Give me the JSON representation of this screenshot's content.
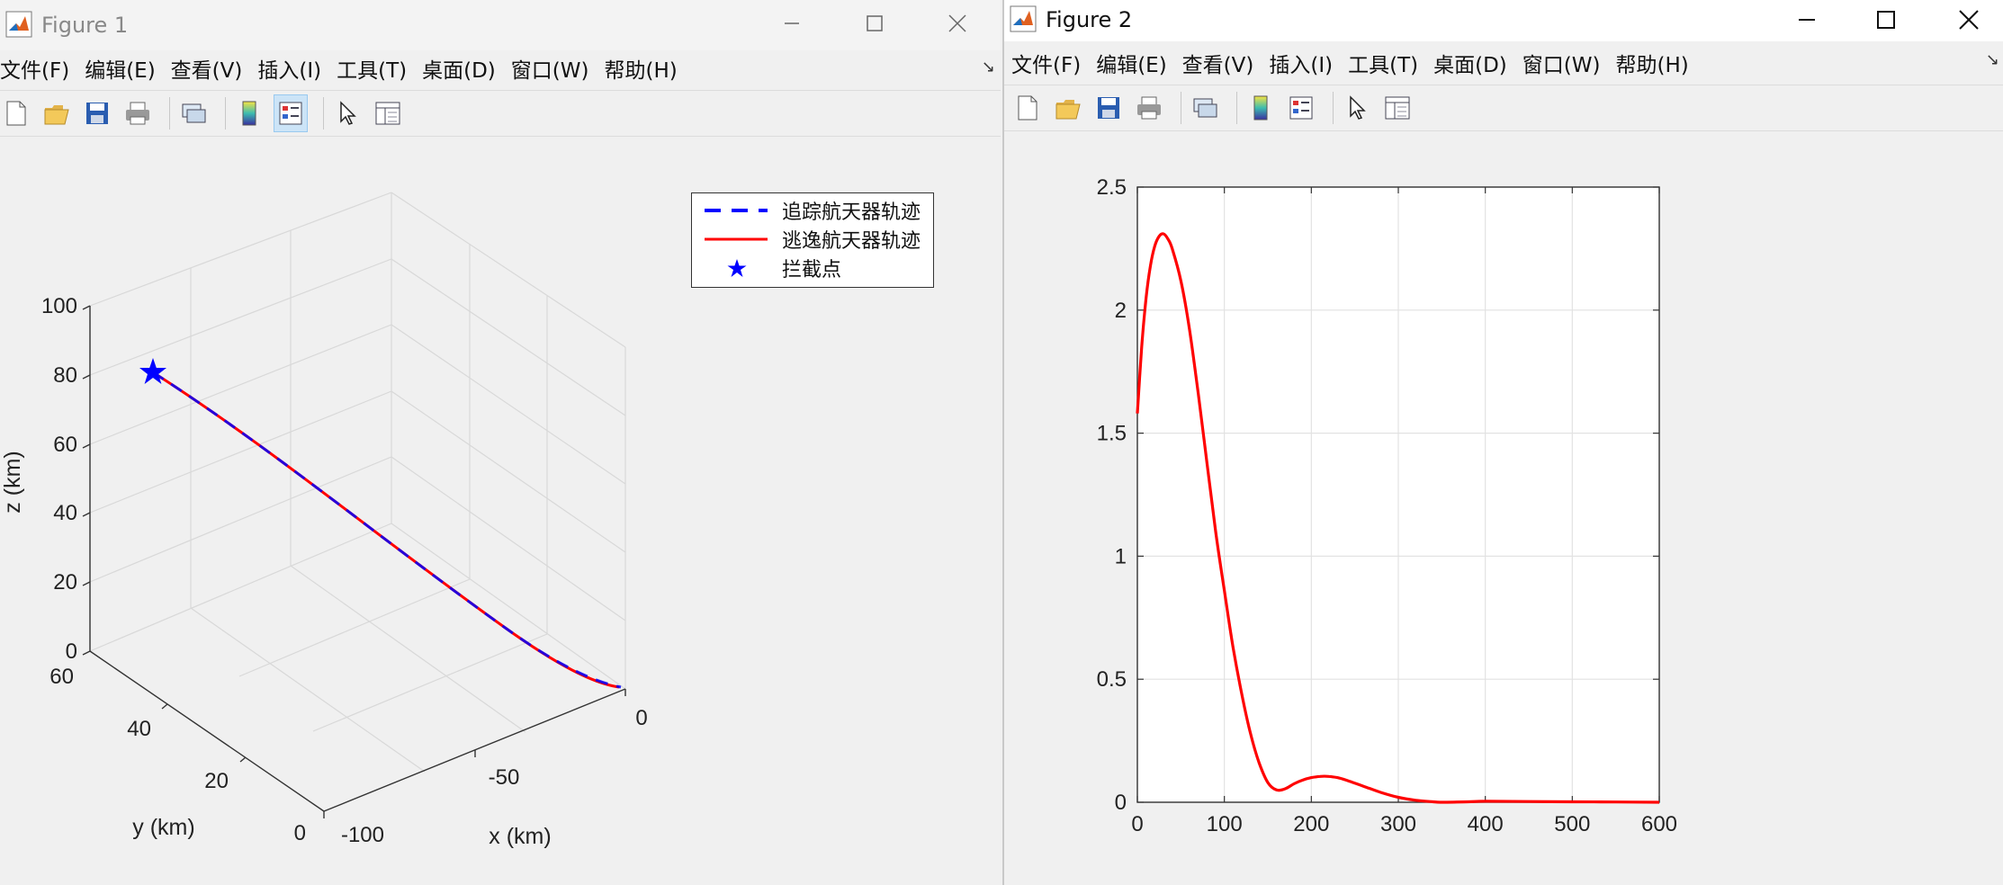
{
  "figure1": {
    "title": "Figure 1",
    "menu": [
      "文件(F)",
      "编辑(E)",
      "查看(V)",
      "插入(I)",
      "工具(T)",
      "桌面(D)",
      "窗口(W)",
      "帮助(H)"
    ],
    "toolbar_icons": [
      "new-figure-icon",
      "open-icon",
      "save-icon",
      "print-icon",
      "link-icon",
      "colorbar-icon",
      "legend-icon",
      "pointer-icon",
      "property-inspector-icon"
    ],
    "axes": {
      "xlabel": "x (km)",
      "ylabel": "y (km)",
      "zlabel": "z (km)",
      "xticks": [
        "-100",
        "-50",
        "0"
      ],
      "yticks": [
        "0",
        "20",
        "40",
        "60"
      ],
      "zticks": [
        "0",
        "20",
        "40",
        "60",
        "80",
        "100"
      ]
    },
    "legend": [
      {
        "label": "追踪航天器轨迹",
        "style": "dashed",
        "color": "#0000ff"
      },
      {
        "label": "逃逸航天器轨迹",
        "style": "solid",
        "color": "#ff0000"
      },
      {
        "label": "拦截点",
        "style": "star",
        "color": "#0000ff"
      }
    ]
  },
  "figure2": {
    "title": "Figure 2",
    "menu": [
      "文件(F)",
      "编辑(E)",
      "查看(V)",
      "插入(I)",
      "工具(T)",
      "桌面(D)",
      "窗口(W)",
      "帮助(H)"
    ],
    "toolbar_icons": [
      "new-figure-icon",
      "open-icon",
      "save-icon",
      "print-icon",
      "link-icon",
      "colorbar-icon",
      "legend-icon",
      "pointer-icon",
      "property-inspector-icon"
    ]
  },
  "chart_data": [
    {
      "type": "line",
      "chart": "figure1-3d",
      "xlim": [
        -100,
        0
      ],
      "ylim": [
        0,
        60
      ],
      "zlim": [
        0,
        100
      ],
      "xlabel": "x (km)",
      "ylabel": "y (km)",
      "zlabel": "z (km)",
      "series": [
        {
          "name": "追踪航天器轨迹",
          "color": "#0000ff",
          "style": "dashed",
          "x": [
            -1,
            -15,
            -30,
            -45,
            -60,
            -75,
            -89
          ],
          "y": [
            1,
            9,
            17,
            25,
            33,
            41,
            49
          ],
          "z": [
            1,
            14,
            27,
            40,
            53,
            66,
            78
          ]
        },
        {
          "name": "逃逸航天器轨迹",
          "color": "#ff0000",
          "style": "solid",
          "x": [
            -1,
            -15,
            -30,
            -45,
            -60,
            -75,
            -89
          ],
          "y": [
            1,
            9,
            17,
            25,
            33,
            41,
            49
          ],
          "z": [
            1,
            14,
            27,
            40,
            53,
            66,
            78
          ]
        }
      ],
      "markers": [
        {
          "name": "拦截点",
          "x": -89,
          "y": 49,
          "z": 78,
          "color": "#0000ff",
          "shape": "star"
        }
      ],
      "grid": true
    },
    {
      "type": "line",
      "chart": "figure2-2d",
      "xlim": [
        0,
        600
      ],
      "ylim": [
        0,
        2.5
      ],
      "xticks": [
        0,
        100,
        200,
        300,
        400,
        500,
        600
      ],
      "yticks": [
        0,
        0.5,
        1,
        1.5,
        2,
        2.5
      ],
      "grid": true,
      "series": [
        {
          "color": "#ff0000",
          "x": [
            0,
            5,
            10,
            15,
            20,
            25,
            30,
            35,
            40,
            50,
            60,
            70,
            80,
            90,
            100,
            110,
            120,
            130,
            140,
            150,
            160,
            170,
            180,
            190,
            200,
            210,
            220,
            230,
            240,
            260,
            280,
            300,
            320,
            340,
            350,
            380,
            400,
            450,
            500,
            550,
            600
          ],
          "y": [
            1.58,
            1.85,
            2.05,
            2.18,
            2.26,
            2.3,
            2.31,
            2.29,
            2.25,
            2.12,
            1.92,
            1.66,
            1.38,
            1.1,
            0.86,
            0.63,
            0.44,
            0.28,
            0.16,
            0.08,
            0.05,
            0.055,
            0.075,
            0.09,
            0.1,
            0.105,
            0.105,
            0.1,
            0.09,
            0.065,
            0.04,
            0.02,
            0.008,
            0.002,
            0.0,
            0.002,
            0.004,
            0.003,
            0.002,
            0.001,
            0.0
          ]
        }
      ]
    }
  ]
}
